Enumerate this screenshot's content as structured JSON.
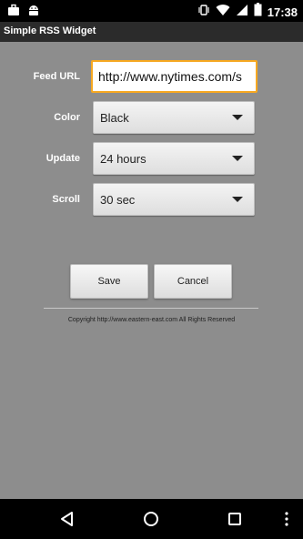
{
  "status_bar": {
    "time": "17:38",
    "icons": [
      "briefcase-icon",
      "android-icon",
      "vibrate-icon",
      "wifi-icon",
      "signal-icon",
      "battery-icon"
    ]
  },
  "app": {
    "title": "Simple RSS Widget"
  },
  "form": {
    "feed_url": {
      "label": "Feed URL",
      "value": "http://www.nytimes.com/s"
    },
    "color": {
      "label": "Color",
      "value": "Black"
    },
    "update": {
      "label": "Update",
      "value": "24 hours"
    },
    "scroll": {
      "label": "Scroll",
      "value": "30 sec"
    }
  },
  "buttons": {
    "save": "Save",
    "cancel": "Cancel"
  },
  "footer": {
    "copyright": "Copyright http://www.eastern-east.com All Rights Reserved"
  },
  "nav": {
    "icons": [
      "back-icon",
      "home-icon",
      "recents-icon",
      "more-icon"
    ]
  },
  "colors": {
    "accent": "#f6a821",
    "background": "#8d8d8d",
    "title_bar": "#2b2b2b"
  }
}
